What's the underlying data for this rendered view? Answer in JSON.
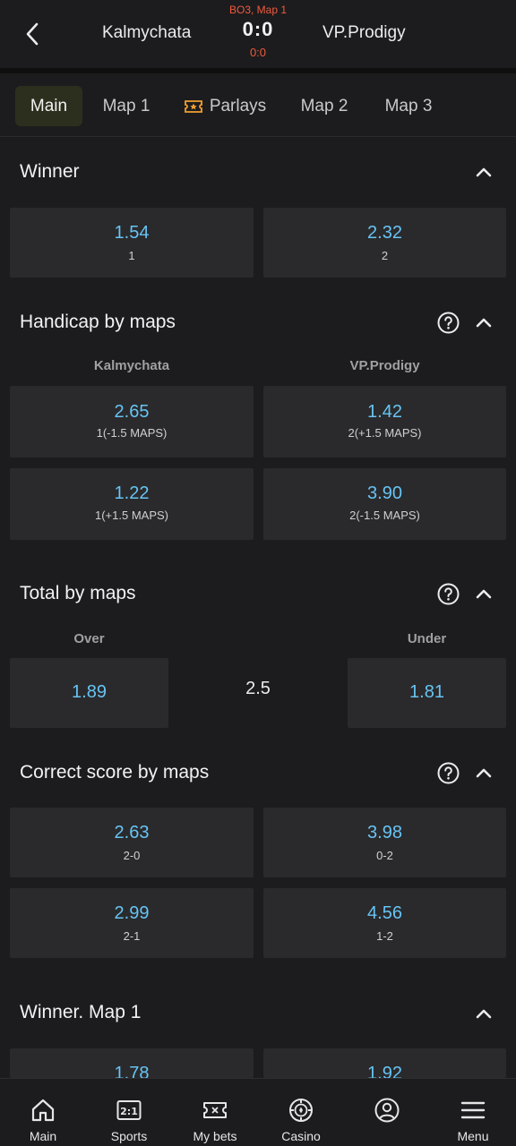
{
  "header": {
    "team_left": "Kalmychata",
    "team_right": "VP.Prodigy",
    "match_info": "BO3, Map 1",
    "score": "0:0",
    "sub_score": "0:0"
  },
  "tabs": [
    {
      "label": "Main",
      "active": true
    },
    {
      "label": "Map 1"
    },
    {
      "label": "Parlays"
    },
    {
      "label": "Map 2"
    },
    {
      "label": "Map 3"
    }
  ],
  "winner": {
    "title": "Winner",
    "odds": [
      {
        "value": "1.54",
        "label": "1"
      },
      {
        "value": "2.32",
        "label": "2"
      }
    ]
  },
  "handicap": {
    "title": "Handicap by maps",
    "col_left": "Kalmychata",
    "col_right": "VP.Prodigy",
    "odds": [
      {
        "value": "2.65",
        "label": "1(-1.5 MAPS)"
      },
      {
        "value": "1.42",
        "label": "2(+1.5 MAPS)"
      },
      {
        "value": "1.22",
        "label": "1(+1.5 MAPS)"
      },
      {
        "value": "3.90",
        "label": "2(-1.5 MAPS)"
      }
    ]
  },
  "total": {
    "title": "Total by maps",
    "col_left": "Over",
    "col_right": "Under",
    "over": "1.89",
    "line": "2.5",
    "under": "1.81"
  },
  "correct_score": {
    "title": "Correct score by maps",
    "odds": [
      {
        "value": "2.63",
        "label": "2-0"
      },
      {
        "value": "3.98",
        "label": "0-2"
      },
      {
        "value": "2.99",
        "label": "2-1"
      },
      {
        "value": "4.56",
        "label": "1-2"
      }
    ]
  },
  "winner_map1": {
    "title": "Winner. Map 1",
    "odds": [
      {
        "value": "1.78"
      },
      {
        "value": "1.92"
      }
    ]
  },
  "bottom_nav": [
    {
      "label": "Main",
      "icon": "home-icon"
    },
    {
      "label": "Sports",
      "icon": "scoreboard-icon"
    },
    {
      "label": "My bets",
      "icon": "ticket-icon"
    },
    {
      "label": "Casino",
      "icon": "casino-chip-icon"
    },
    {
      "label": "",
      "icon": "profile-icon"
    },
    {
      "label": "Menu",
      "icon": "hamburger-menu-icon"
    }
  ],
  "colors": {
    "background": "#1c1c1e",
    "card": "#2a2a2c",
    "odd_value": "#67c4f4",
    "live_accent": "#f05a3e",
    "active_tab": "#2d2f1e",
    "parlay_icon": "#f0a030"
  }
}
